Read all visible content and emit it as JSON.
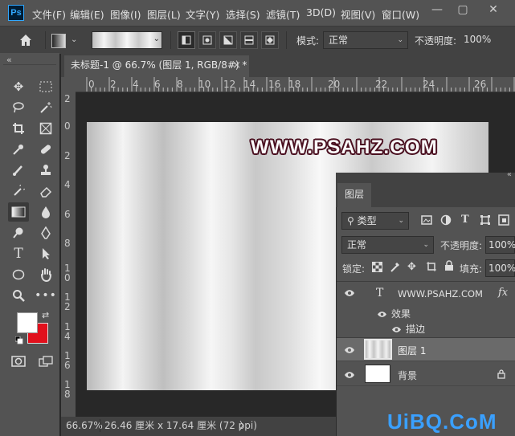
{
  "app": {
    "logo": "Ps"
  },
  "menu": [
    "文件(F)",
    "编辑(E)",
    "图像(I)",
    "图层(L)",
    "文字(Y)",
    "选择(S)",
    "滤镜(T)",
    "3D(D)",
    "视图(V)",
    "窗口(W)"
  ],
  "window_controls": {
    "minimize": "—",
    "restore": "▢",
    "close": "✕"
  },
  "options": {
    "home_icon": "home-icon",
    "mode_label": "模式:",
    "mode_value": "正常",
    "opacity_label": "不透明度:",
    "opacity_value": "100%"
  },
  "document": {
    "tab_title": "未标题-1 @ 66.7% (图层 1, RGB/8#) *",
    "tab_close": "×",
    "canvas_text": "WWW.PSAHZ.COM"
  },
  "ruler": {
    "top": [
      "0",
      "2",
      "4",
      "6",
      "8",
      "10",
      "12",
      "14",
      "16",
      "18",
      "20",
      "22",
      "24",
      "26"
    ],
    "left": [
      "2",
      "0",
      "2",
      "4",
      "6",
      "8",
      "1\n0",
      "1\n2",
      "1\n4",
      "1\n6",
      "1\n8"
    ]
  },
  "status": {
    "zoom": "66.67%",
    "doc_size": "26.46 厘米 x 17.64 厘米 (72 ppi)",
    "arrow": "〉"
  },
  "layers_panel": {
    "tab": "图层",
    "filter_label": "类型",
    "blend_mode": "正常",
    "opacity_label": "不透明度:",
    "opacity_value": "100%",
    "lock_label": "锁定:",
    "fill_label": "填充:",
    "fill_value": "100%",
    "layers": [
      {
        "name": "WWW.PSAHZ.COM",
        "type": "text",
        "badge": "fx",
        "glyph": "T"
      },
      {
        "name": "效果",
        "type": "effects"
      },
      {
        "name": "描边",
        "type": "effect"
      },
      {
        "name": "图层 1",
        "type": "pixel",
        "selected": true
      },
      {
        "name": "背景",
        "type": "background",
        "locked": true
      }
    ]
  },
  "tools": {
    "toggle": "«",
    "swap": "⇄"
  },
  "colors": {
    "foreground": "#ffffff",
    "background": "#e1101c",
    "accent": "#31a8ff"
  },
  "site_watermark": "UiBQ.CoM"
}
